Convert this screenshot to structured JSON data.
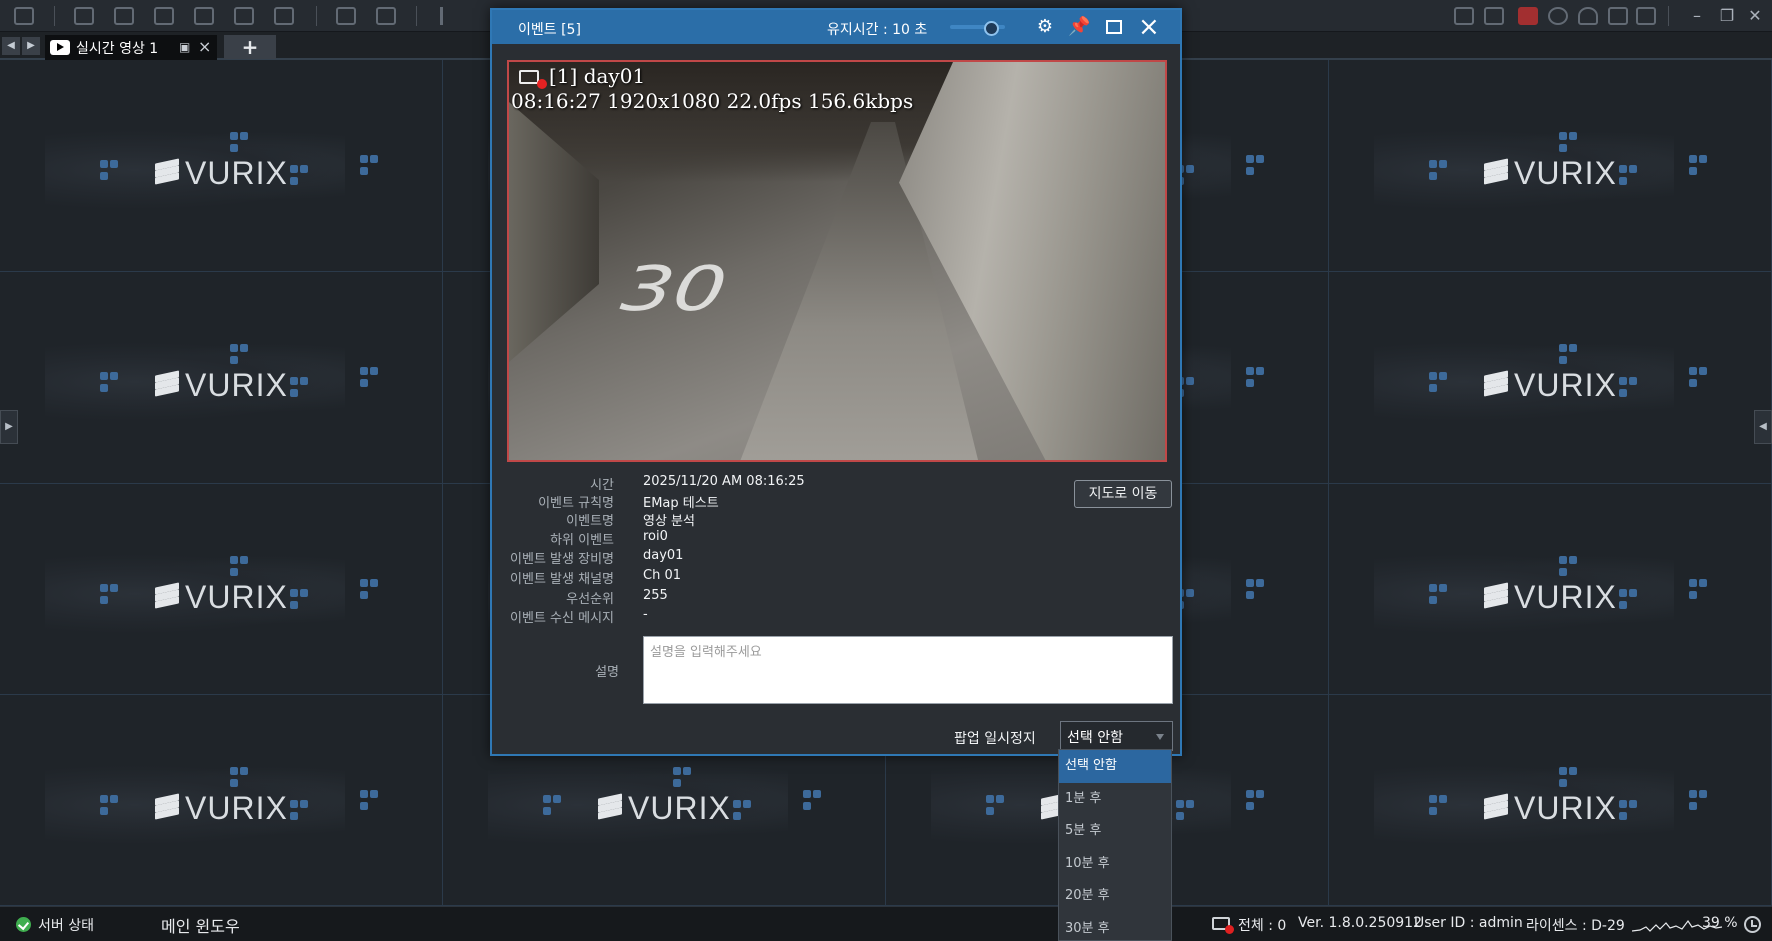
{
  "toolbar": {
    "icons": [
      "grid-icon",
      "live-video-icon",
      "search-video-icon",
      "lpr-icon",
      "layout-icon",
      "face-search-icon",
      "globe-search-icon",
      "monitor-icon",
      "add-monitor-icon",
      "prev-icon"
    ],
    "right_icons": [
      "chat-icon",
      "event-list-icon",
      "alarm-icon",
      "settings-icon",
      "user-icon",
      "move-icon",
      "fullscreen-icon"
    ],
    "window_controls": {
      "minimize": "–",
      "restore": "❐",
      "close": "✕"
    }
  },
  "tabs": {
    "nav_prev": "◀",
    "nav_next": "▶",
    "active_label": "실시간 영상 1",
    "add_label": "+"
  },
  "grid": {
    "logo_text": "VURIX"
  },
  "dialog": {
    "title": "이벤트 [5]",
    "hold_time": "유지시간 : 10 초",
    "hold_slider_fraction": 0.75,
    "video": {
      "osd_line1": "[1] day01",
      "osd_line2": "08:16:27 1920x1080 22.0fps 156.6kbps",
      "road_marking": "30"
    },
    "map_button": "지도로 이동",
    "fields": [
      {
        "label": "시간",
        "value": "2025/11/20 AM 08:16:25"
      },
      {
        "label": "이벤트 규칙명",
        "value": "EMap 테스트"
      },
      {
        "label": "이벤트명",
        "value": "영상 분석"
      },
      {
        "label": "하위 이벤트",
        "value": "roi0"
      },
      {
        "label": "이벤트 발생 장비명",
        "value": "day01"
      },
      {
        "label": "이벤트 발생 채널명",
        "value": "Ch 01"
      },
      {
        "label": "우선순위",
        "value": "255"
      },
      {
        "label": "이벤트 수신 메시지",
        "value": "-"
      }
    ],
    "description_label": "설명",
    "description_placeholder": "설명을 입력해주세요",
    "pause_label": "팝업 일시정지",
    "pause_selected": "선택 안함",
    "pause_options": [
      "선택 안함",
      "1분 후",
      "5분 후",
      "10분 후",
      "20분 후",
      "30분 후"
    ]
  },
  "statusbar": {
    "server_status": "서버 상태",
    "main_window": "메인 윈도우",
    "total": "전체 : 0",
    "version": "Ver. 1.8.0.250912",
    "user_id": "User ID : admin",
    "license": "라이센스 : D-29",
    "cpu": "39 %"
  },
  "colors": {
    "accent": "#2b6ea8",
    "video_border": "#c04848",
    "ok": "#3fae4f",
    "alert": "#e02020"
  }
}
